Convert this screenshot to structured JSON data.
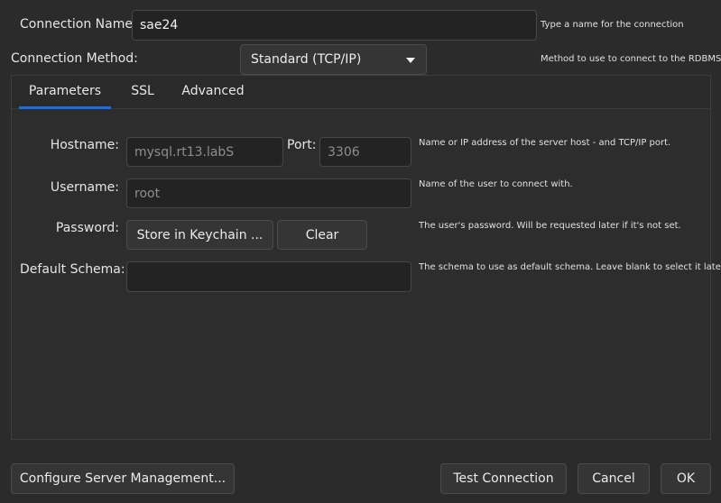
{
  "connection_name": {
    "label": "Connection Name:",
    "value": "sae24",
    "hint": "Type a name for the connection"
  },
  "connection_method": {
    "label": "Connection Method:",
    "selected": "Standard (TCP/IP)",
    "hint": "Method to use to connect to the RDBMS"
  },
  "tabs": [
    {
      "label": "Parameters",
      "active": true
    },
    {
      "label": "SSL",
      "active": false
    },
    {
      "label": "Advanced",
      "active": false
    }
  ],
  "parameters": {
    "hostname": {
      "label": "Hostname:",
      "value": "mysql.rt13.labS",
      "hint": "Name or IP address of the server host - and TCP/IP port."
    },
    "port": {
      "label": "Port:",
      "value": "3306"
    },
    "username": {
      "label": "Username:",
      "value": "root",
      "hint": "Name of the user to connect with."
    },
    "password": {
      "label": "Password:",
      "store_button": "Store in Keychain ...",
      "clear_button": "Clear",
      "hint": "The user's password. Will be requested later if it's not set."
    },
    "default_schema": {
      "label": "Default Schema:",
      "value": "",
      "hint": "The schema to use as default schema. Leave blank to select it later."
    }
  },
  "footer": {
    "configure_button": "Configure Server Management...",
    "test_button": "Test Connection",
    "cancel_button": "Cancel",
    "ok_button": "OK"
  },
  "colors": {
    "background": "#2b2b2b",
    "accent": "#2e6bc7"
  }
}
